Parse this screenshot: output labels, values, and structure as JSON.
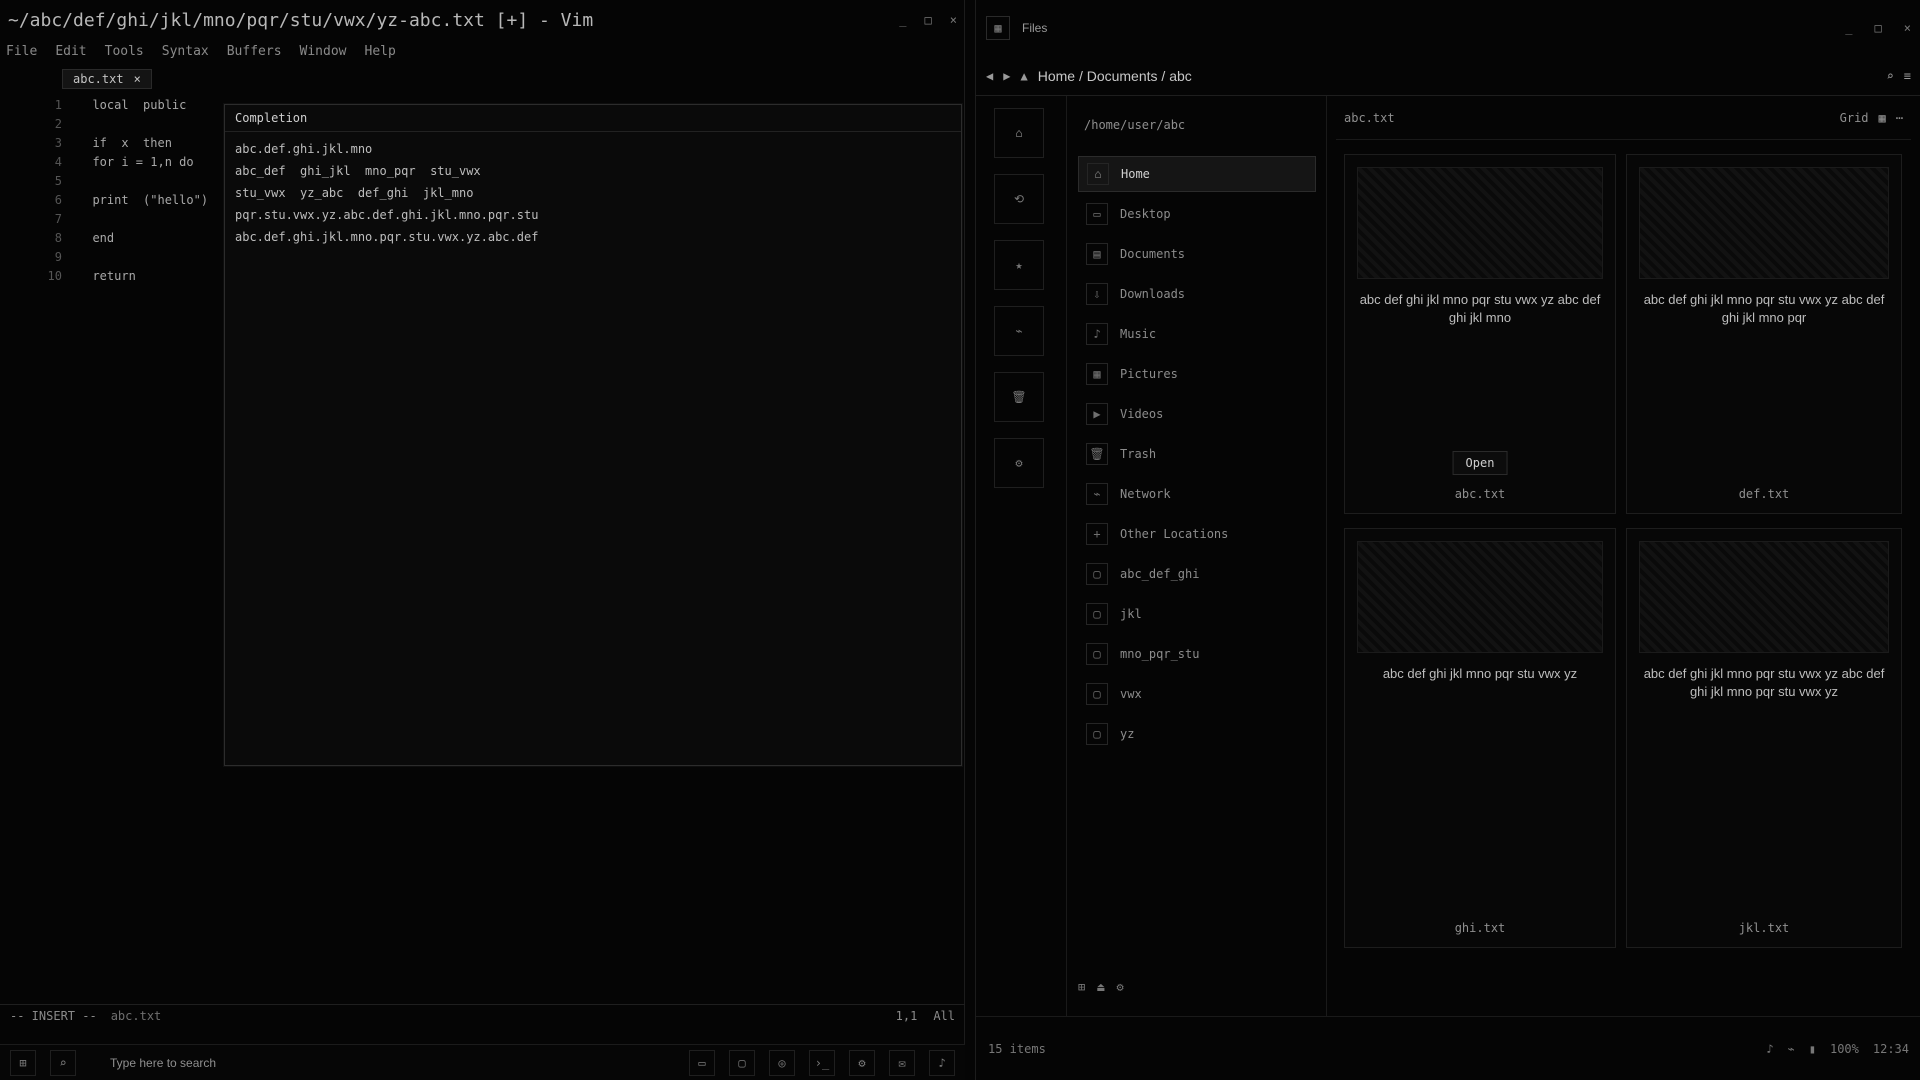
{
  "editor": {
    "title": "~/abc/def/ghi/jkl/mno/pqr/stu/vwx/yz-abc.txt [+] - Vim",
    "window_buttons": [
      "_",
      "□",
      "×"
    ],
    "menu": [
      "File",
      "Edit",
      "Tools",
      "Syntax",
      "Buffers",
      "Window",
      "Help"
    ],
    "tab_label": "abc.txt",
    "line_numbers": [
      "1",
      "2",
      "3",
      "4",
      "5",
      "6",
      "7",
      "8",
      "9",
      "10"
    ],
    "code_lines": [
      "  local  public  ",
      "",
      "  if  x  then",
      "  for i = 1,n do",
      "",
      "  print  (\"hello\")",
      "",
      "  end",
      "",
      "  return"
    ],
    "popup": {
      "header": "Completion",
      "rows": [
        "abc.def.ghi.jkl.mno",
        "abc_def  ghi_jkl  mno_pqr  stu_vwx",
        "stu_vwx  yz_abc  def_ghi  jkl_mno",
        "pqr.stu.vwx.yz.abc.def.ghi.jkl.mno.pqr.stu",
        "abc.def.ghi.jkl.mno.pqr.stu.vwx.yz.abc.def"
      ]
    },
    "status_left": "-- INSERT --",
    "status_mid": "abc.txt",
    "status_right": [
      "1,1",
      "All"
    ]
  },
  "taskbar": {
    "search_label": "Type here to search",
    "icons": [
      "start-icon",
      "search-icon",
      "task-view-icon",
      "folder-icon",
      "browser-icon",
      "terminal-icon",
      "settings-icon",
      "chat-icon",
      "music-icon"
    ]
  },
  "browser": {
    "title": "Files",
    "addr": "Home / Documents / abc",
    "side_path": "/home/user/abc",
    "side_items": [
      {
        "label": "Home",
        "selected": true
      },
      {
        "label": "Desktop",
        "selected": false
      },
      {
        "label": "Documents",
        "selected": false
      },
      {
        "label": "Downloads",
        "selected": false
      },
      {
        "label": "Music",
        "selected": false
      },
      {
        "label": "Pictures",
        "selected": false
      },
      {
        "label": "Videos",
        "selected": false
      },
      {
        "label": "Trash",
        "selected": false
      },
      {
        "label": "Network",
        "selected": false
      },
      {
        "label": "Other Locations",
        "selected": false
      },
      {
        "label": "abc_def_ghi",
        "selected": false
      },
      {
        "label": "jkl",
        "selected": false
      },
      {
        "label": "mno_pqr_stu",
        "selected": false
      },
      {
        "label": "vwx",
        "selected": false
      },
      {
        "label": "yz",
        "selected": false
      }
    ],
    "toprow": {
      "left": "abc.txt",
      "right": "Grid"
    },
    "cards": [
      {
        "title": "abc def ghi jkl mno pqr stu vwx yz abc def ghi jkl mno",
        "button": "Open",
        "sub": "abc.txt"
      },
      {
        "title": "abc def ghi jkl mno pqr stu vwx yz abc def ghi jkl mno pqr",
        "button": "",
        "sub": "def.txt"
      },
      {
        "title": "abc def ghi jkl mno pqr stu vwx yz",
        "button": "",
        "sub": "ghi.txt"
      },
      {
        "title": "abc def ghi jkl mno pqr stu vwx yz abc def ghi jkl mno pqr stu vwx yz",
        "button": "",
        "sub": "jkl.txt"
      }
    ],
    "status_left": "15 items",
    "status_right": [
      "100%",
      "12:34"
    ]
  }
}
